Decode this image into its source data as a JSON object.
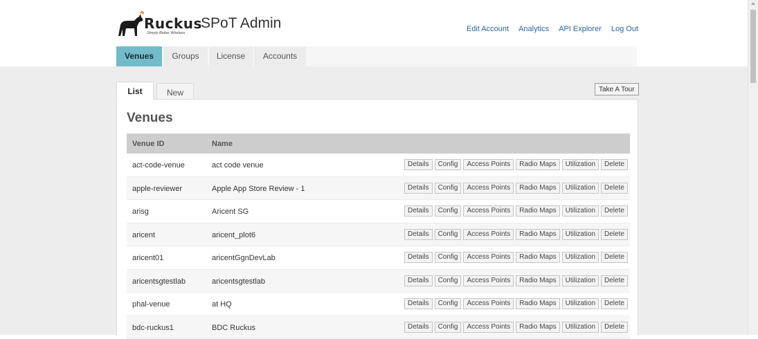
{
  "brand": {
    "logo_word": "Ruckus",
    "tagline": "Simply Better Wireless.",
    "app_title": "SPoT Admin"
  },
  "top_links": [
    "Edit Account",
    "Analytics",
    "API Explorer",
    "Log Out"
  ],
  "main_nav": [
    {
      "label": "Venues",
      "active": true
    },
    {
      "label": "Groups",
      "active": false
    },
    {
      "label": "License",
      "active": false
    },
    {
      "label": "Accounts",
      "active": false
    }
  ],
  "subtabs": {
    "list": "List",
    "new": "New"
  },
  "take_tour": "Take A Tour",
  "page_title": "Venues",
  "table": {
    "headers": [
      "Venue ID",
      "Name"
    ],
    "action_labels": [
      "Details",
      "Config",
      "Access Points",
      "Radio Maps",
      "Utilization",
      "Delete"
    ],
    "rows": [
      {
        "id": "act-code-venue",
        "name": "act code venue"
      },
      {
        "id": "apple-reviewer",
        "name": "Apple App Store Review - 1"
      },
      {
        "id": "arisg",
        "name": "Aricent SG"
      },
      {
        "id": "aricent",
        "name": "aricent_plot6"
      },
      {
        "id": "aricent01",
        "name": "aricentGgnDevLab"
      },
      {
        "id": "aricentsgtestlab",
        "name": "aricentsgtestlab"
      },
      {
        "id": "phal-venue",
        "name": "at HQ"
      },
      {
        "id": "bdc-ruckus1",
        "name": "BDC Ruckus"
      }
    ]
  },
  "colors": {
    "active_tab": "#72bcc9",
    "link": "#2a63a8",
    "header_row": "#cdcdcd",
    "page_band": "#ededed"
  }
}
